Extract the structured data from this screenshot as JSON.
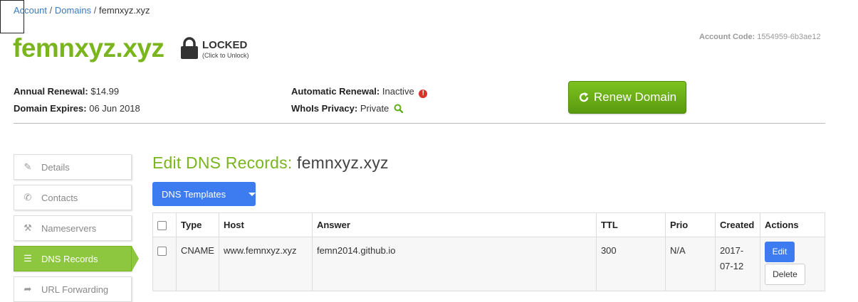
{
  "breadcrumb": {
    "items": [
      "Account",
      "Domains"
    ],
    "separator": "/",
    "current": "femnxyz.xyz"
  },
  "domain": {
    "name": "femnxyz.xyz",
    "lock_status": "LOCKED",
    "lock_hint": "(Click to Unlock)"
  },
  "account_code": {
    "label": "Account Code:",
    "value": "1554959-6b3ae12"
  },
  "info": {
    "annual_renewal_label": "Annual Renewal:",
    "annual_renewal_value": "$14.99",
    "domain_expires_label": "Domain Expires:",
    "domain_expires_value": "06 Jun 2018",
    "auto_renewal_label": "Automatic Renewal:",
    "auto_renewal_value": "Inactive",
    "whois_label": "WhoIs Privacy:",
    "whois_value": "Private"
  },
  "renew_button": "Renew Domain",
  "sidebar": {
    "items": [
      {
        "label": "Details",
        "icon": "pencil-icon"
      },
      {
        "label": "Contacts",
        "icon": "phone-icon"
      },
      {
        "label": "Nameservers",
        "icon": "wrench-icon"
      },
      {
        "label": "DNS Records",
        "icon": "list-icon"
      },
      {
        "label": "URL Forwarding",
        "icon": "share-icon"
      }
    ],
    "active_index": 3
  },
  "section": {
    "title": "Edit DNS Records:",
    "domain": "femnxyz.xyz"
  },
  "dns_templates_button": "DNS Templates",
  "table": {
    "headers": [
      "Type",
      "Host",
      "Answer",
      "TTL",
      "Prio",
      "Created",
      "Actions"
    ],
    "rows": [
      {
        "type": "CNAME",
        "host": "www.femnxyz.xyz",
        "answer": "femn2014.github.io",
        "ttl": "300",
        "prio": "N/A",
        "created_line1": "2017-",
        "created_line2": "07-12",
        "edit": "Edit",
        "delete": "Delete"
      }
    ]
  },
  "colors": {
    "brand_green": "#7ab51d",
    "link_blue": "#3a7bbf",
    "primary_blue": "#3d7bf0",
    "alert_red": "#d9342b"
  }
}
